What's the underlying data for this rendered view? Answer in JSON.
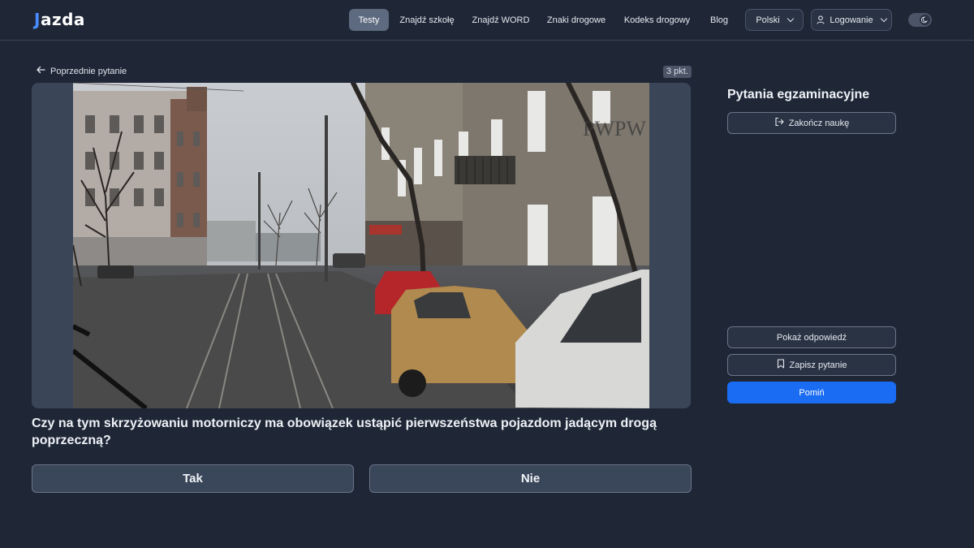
{
  "header": {
    "logo": {
      "prefix": "J",
      "rest": "azda"
    },
    "nav": [
      {
        "label": "Testy",
        "active": true
      },
      {
        "label": "Znajdź szkołę"
      },
      {
        "label": "Znajdź WORD"
      },
      {
        "label": "Znaki drogowe"
      },
      {
        "label": "Kodeks drogowy"
      },
      {
        "label": "Blog"
      }
    ],
    "language_label": "Polski",
    "login_label": "Logowanie",
    "theme_toggle_icon": "moon-icon"
  },
  "question_view": {
    "back_label": "Poprzednie pytanie",
    "points_label": "3 pkt.",
    "media_watermark": "PWPW",
    "question_text": "Czy na tym skrzyżowaniu motorniczy ma obowiązek ustąpić pierwszeństwa pojazdom jadącym drogą poprzeczną?",
    "answers": [
      "Tak",
      "Nie"
    ]
  },
  "sidebar": {
    "title": "Pytania egzaminacyjne",
    "end_label": "Zakończ naukę",
    "show_answer_label": "Pokaż odpowiedź",
    "save_label": "Zapisz pytanie",
    "skip_label": "Pomiń"
  },
  "colors": {
    "background": "#1f2737",
    "accent": "#1a6cf2",
    "logo_accent": "#4a8cff"
  }
}
